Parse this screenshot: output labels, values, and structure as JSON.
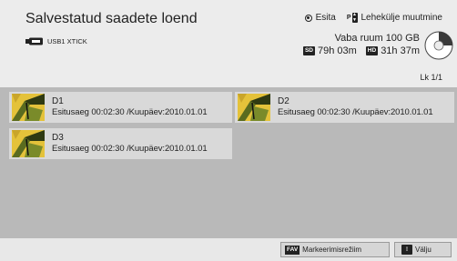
{
  "header": {
    "title": "Salvestatud saadete loend",
    "usb_label": "USB1 XTICK",
    "legend": {
      "play_label": "Esita",
      "page_change_label": "Lehekülje muutmine"
    },
    "free_space": "Vaba ruum 100 GB",
    "sd_badge": "SD",
    "sd_time": "79h 03m",
    "hd_badge": "HD",
    "hd_time": "31h 37m",
    "page_indicator": "Lk 1/1",
    "disk_used_fraction": 0.25
  },
  "recordings": [
    {
      "name": "D1",
      "meta": "Esitusaeg 00:02:30 /Kuupäev:2010.01.01"
    },
    {
      "name": "D2",
      "meta": "Esitusaeg 00:02:30 /Kuupäev:2010.01.01"
    },
    {
      "name": "D3",
      "meta": "Esitusaeg 00:02:30 /Kuupäev:2010.01.01"
    }
  ],
  "footer": {
    "fav_badge": "FAV",
    "mark_mode_label": "Markeerimisrežiim",
    "exit_label": "Välju"
  },
  "colors": {
    "background": "#b9b9b9",
    "panel": "#ececec",
    "thumb_yellow": "#e4c23a"
  },
  "icons": {
    "usb": "usb-stick-icon",
    "play": "radio-dot-icon",
    "page": "page-change-icon",
    "disk": "disk-usage-icon",
    "thumb": "butterfly-thumbnail-icon",
    "exit": "exit-icon"
  }
}
